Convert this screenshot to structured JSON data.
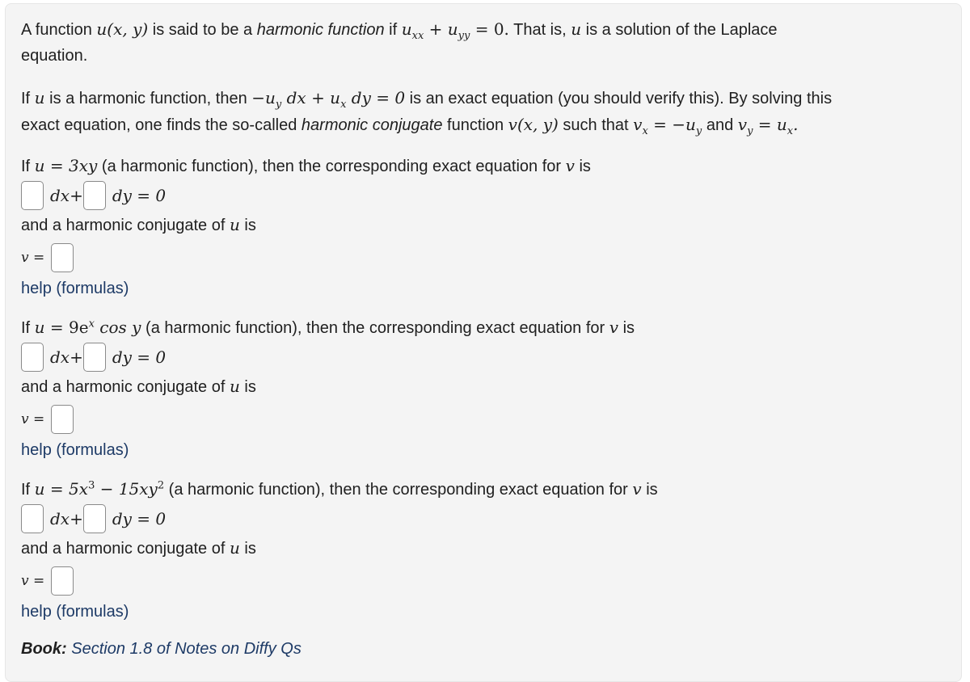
{
  "intro": {
    "p1_a": "A function ",
    "p1_uxy": "u(x, y)",
    "p1_b": " is said to be a ",
    "p1_em": "harmonic function",
    "p1_c": " if ",
    "p1_eq": "u",
    "p1_sub1": "xx",
    "p1_plus": " + u",
    "p1_sub2": "yy",
    "p1_eq_end": " = 0.",
    "p1_d": " That is, ",
    "p1_u": "u",
    "p1_e": " is a solution of the Laplace",
    "p1_f": "equation.",
    "p2_a": "If ",
    "p2_u": "u",
    "p2_b": " is a harmonic function, then ",
    "p2_eq": "−u",
    "p2_sub_y": "y",
    "p2_eq2": " dx + u",
    "p2_sub_x": "x",
    "p2_eq3": " dy = 0",
    "p2_c": " is an exact equation (you should verify this). By solving this",
    "p2_d": "exact equation, one finds the so-called ",
    "p2_em": "harmonic conjugate",
    "p2_e": " function ",
    "p2_vxy": "v(x, y)",
    "p2_f": " such that ",
    "p2_vx": "v",
    "p2_vx_sub": "x",
    "p2_vx_eq": " = −u",
    "p2_vx_rhs_sub": "y",
    "p2_g": " and ",
    "p2_vy": "v",
    "p2_vy_sub": "y",
    "p2_vy_eq": " = u",
    "p2_vy_rhs_sub": "x",
    "p2_end": "."
  },
  "problems": [
    {
      "lead": "If ",
      "u_label": "u",
      "equals": " = ",
      "func": "3xy",
      "tail_a": " (a harmonic function), then the corresponding exact equation for ",
      "v_label": "v",
      "tail_b": " is",
      "dx": "dx+",
      "dy": "dy = 0",
      "conj_a": "and a harmonic conjugate of ",
      "conj_u": "u",
      "conj_b": " is",
      "v_eq": "v =",
      "answers": {
        "dx_coef": "",
        "dy_coef": "",
        "v": ""
      },
      "help": "help (formulas)"
    },
    {
      "lead": "If ",
      "u_label": "u",
      "equals": " = ",
      "func_a": "9e",
      "func_sup": "x",
      "func_b": " cos y",
      "tail_a": " (a harmonic function), then the corresponding exact equation for ",
      "v_label": "v",
      "tail_b": " is",
      "dx": "dx+",
      "dy": "dy = 0",
      "conj_a": "and a harmonic conjugate of ",
      "conj_u": "u",
      "conj_b": " is",
      "v_eq": "v =",
      "answers": {
        "dx_coef": "",
        "dy_coef": "",
        "v": ""
      },
      "help": "help (formulas)"
    },
    {
      "lead": "If ",
      "u_label": "u",
      "equals": " = ",
      "func_a": "5x",
      "func_sup1": "3",
      "func_b": " − 15xy",
      "func_sup2": "2",
      "tail_a": " (a harmonic function), then the corresponding exact equation for ",
      "v_label": "v",
      "tail_b": " is",
      "dx": "dx+",
      "dy": "dy = 0",
      "conj_a": "and a harmonic conjugate of ",
      "conj_u": "u",
      "conj_b": " is",
      "v_eq": "v =",
      "answers": {
        "dx_coef": "",
        "dy_coef": "",
        "v": ""
      },
      "help": "help (formulas)"
    }
  ],
  "book": {
    "label": "Book:",
    "link": "Section 1.8 of Notes on Diffy Qs"
  }
}
